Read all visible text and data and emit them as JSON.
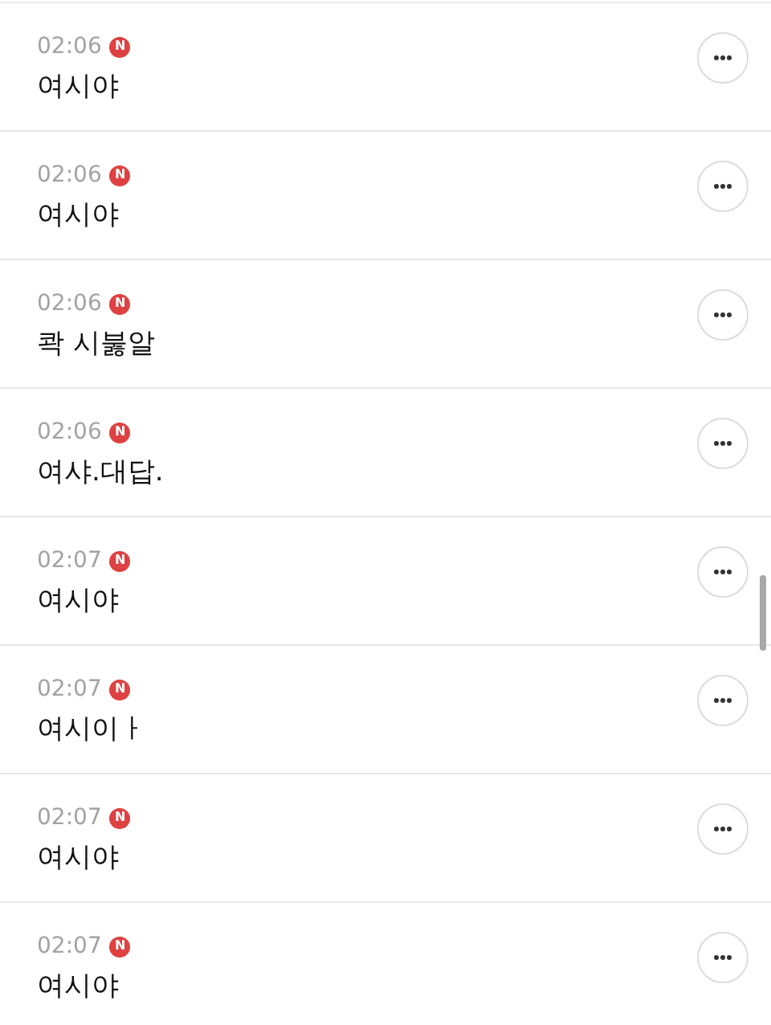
{
  "messages": [
    {
      "time": "02:06",
      "badge": "N",
      "text": "여시야"
    },
    {
      "time": "02:06",
      "badge": "N",
      "text": "여시야"
    },
    {
      "time": "02:06",
      "badge": "N",
      "text": "콱 시붏알"
    },
    {
      "time": "02:06",
      "badge": "N",
      "text": "여샤.대답."
    },
    {
      "time": "02:07",
      "badge": "N",
      "text": "여시야"
    },
    {
      "time": "02:07",
      "badge": "N",
      "text": "여시이ㅏ"
    },
    {
      "time": "02:07",
      "badge": "N",
      "text": "여시야"
    },
    {
      "time": "02:07",
      "badge": "N",
      "text": "여시야"
    }
  ]
}
